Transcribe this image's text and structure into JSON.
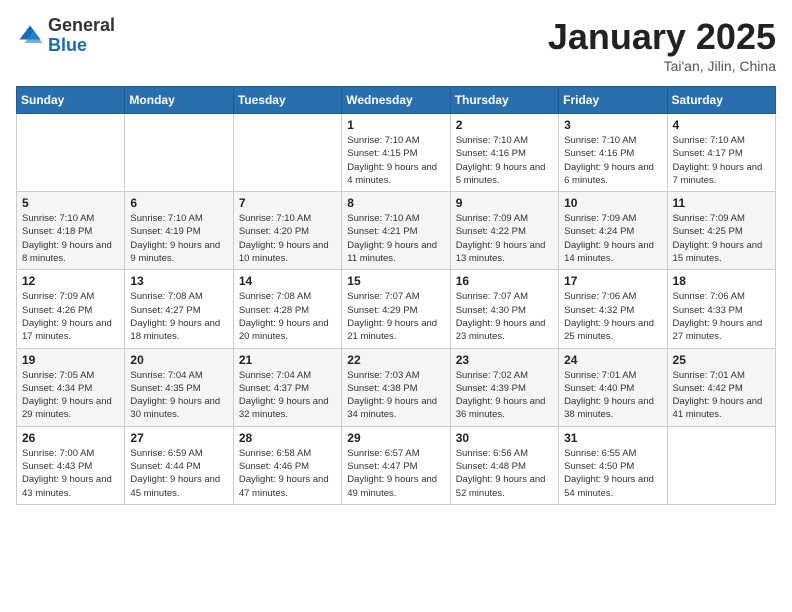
{
  "logo": {
    "general": "General",
    "blue": "Blue"
  },
  "header": {
    "month": "January 2025",
    "location": "Tai'an, Jilin, China"
  },
  "weekdays": [
    "Sunday",
    "Monday",
    "Tuesday",
    "Wednesday",
    "Thursday",
    "Friday",
    "Saturday"
  ],
  "weeks": [
    [
      {
        "day": "",
        "info": ""
      },
      {
        "day": "",
        "info": ""
      },
      {
        "day": "",
        "info": ""
      },
      {
        "day": "1",
        "info": "Sunrise: 7:10 AM\nSunset: 4:15 PM\nDaylight: 9 hours and 4 minutes."
      },
      {
        "day": "2",
        "info": "Sunrise: 7:10 AM\nSunset: 4:16 PM\nDaylight: 9 hours and 5 minutes."
      },
      {
        "day": "3",
        "info": "Sunrise: 7:10 AM\nSunset: 4:16 PM\nDaylight: 9 hours and 6 minutes."
      },
      {
        "day": "4",
        "info": "Sunrise: 7:10 AM\nSunset: 4:17 PM\nDaylight: 9 hours and 7 minutes."
      }
    ],
    [
      {
        "day": "5",
        "info": "Sunrise: 7:10 AM\nSunset: 4:18 PM\nDaylight: 9 hours and 8 minutes."
      },
      {
        "day": "6",
        "info": "Sunrise: 7:10 AM\nSunset: 4:19 PM\nDaylight: 9 hours and 9 minutes."
      },
      {
        "day": "7",
        "info": "Sunrise: 7:10 AM\nSunset: 4:20 PM\nDaylight: 9 hours and 10 minutes."
      },
      {
        "day": "8",
        "info": "Sunrise: 7:10 AM\nSunset: 4:21 PM\nDaylight: 9 hours and 11 minutes."
      },
      {
        "day": "9",
        "info": "Sunrise: 7:09 AM\nSunset: 4:22 PM\nDaylight: 9 hours and 13 minutes."
      },
      {
        "day": "10",
        "info": "Sunrise: 7:09 AM\nSunset: 4:24 PM\nDaylight: 9 hours and 14 minutes."
      },
      {
        "day": "11",
        "info": "Sunrise: 7:09 AM\nSunset: 4:25 PM\nDaylight: 9 hours and 15 minutes."
      }
    ],
    [
      {
        "day": "12",
        "info": "Sunrise: 7:09 AM\nSunset: 4:26 PM\nDaylight: 9 hours and 17 minutes."
      },
      {
        "day": "13",
        "info": "Sunrise: 7:08 AM\nSunset: 4:27 PM\nDaylight: 9 hours and 18 minutes."
      },
      {
        "day": "14",
        "info": "Sunrise: 7:08 AM\nSunset: 4:28 PM\nDaylight: 9 hours and 20 minutes."
      },
      {
        "day": "15",
        "info": "Sunrise: 7:07 AM\nSunset: 4:29 PM\nDaylight: 9 hours and 21 minutes."
      },
      {
        "day": "16",
        "info": "Sunrise: 7:07 AM\nSunset: 4:30 PM\nDaylight: 9 hours and 23 minutes."
      },
      {
        "day": "17",
        "info": "Sunrise: 7:06 AM\nSunset: 4:32 PM\nDaylight: 9 hours and 25 minutes."
      },
      {
        "day": "18",
        "info": "Sunrise: 7:06 AM\nSunset: 4:33 PM\nDaylight: 9 hours and 27 minutes."
      }
    ],
    [
      {
        "day": "19",
        "info": "Sunrise: 7:05 AM\nSunset: 4:34 PM\nDaylight: 9 hours and 29 minutes."
      },
      {
        "day": "20",
        "info": "Sunrise: 7:04 AM\nSunset: 4:35 PM\nDaylight: 9 hours and 30 minutes."
      },
      {
        "day": "21",
        "info": "Sunrise: 7:04 AM\nSunset: 4:37 PM\nDaylight: 9 hours and 32 minutes."
      },
      {
        "day": "22",
        "info": "Sunrise: 7:03 AM\nSunset: 4:38 PM\nDaylight: 9 hours and 34 minutes."
      },
      {
        "day": "23",
        "info": "Sunrise: 7:02 AM\nSunset: 4:39 PM\nDaylight: 9 hours and 36 minutes."
      },
      {
        "day": "24",
        "info": "Sunrise: 7:01 AM\nSunset: 4:40 PM\nDaylight: 9 hours and 38 minutes."
      },
      {
        "day": "25",
        "info": "Sunrise: 7:01 AM\nSunset: 4:42 PM\nDaylight: 9 hours and 41 minutes."
      }
    ],
    [
      {
        "day": "26",
        "info": "Sunrise: 7:00 AM\nSunset: 4:43 PM\nDaylight: 9 hours and 43 minutes."
      },
      {
        "day": "27",
        "info": "Sunrise: 6:59 AM\nSunset: 4:44 PM\nDaylight: 9 hours and 45 minutes."
      },
      {
        "day": "28",
        "info": "Sunrise: 6:58 AM\nSunset: 4:46 PM\nDaylight: 9 hours and 47 minutes."
      },
      {
        "day": "29",
        "info": "Sunrise: 6:57 AM\nSunset: 4:47 PM\nDaylight: 9 hours and 49 minutes."
      },
      {
        "day": "30",
        "info": "Sunrise: 6:56 AM\nSunset: 4:48 PM\nDaylight: 9 hours and 52 minutes."
      },
      {
        "day": "31",
        "info": "Sunrise: 6:55 AM\nSunset: 4:50 PM\nDaylight: 9 hours and 54 minutes."
      },
      {
        "day": "",
        "info": ""
      }
    ]
  ]
}
